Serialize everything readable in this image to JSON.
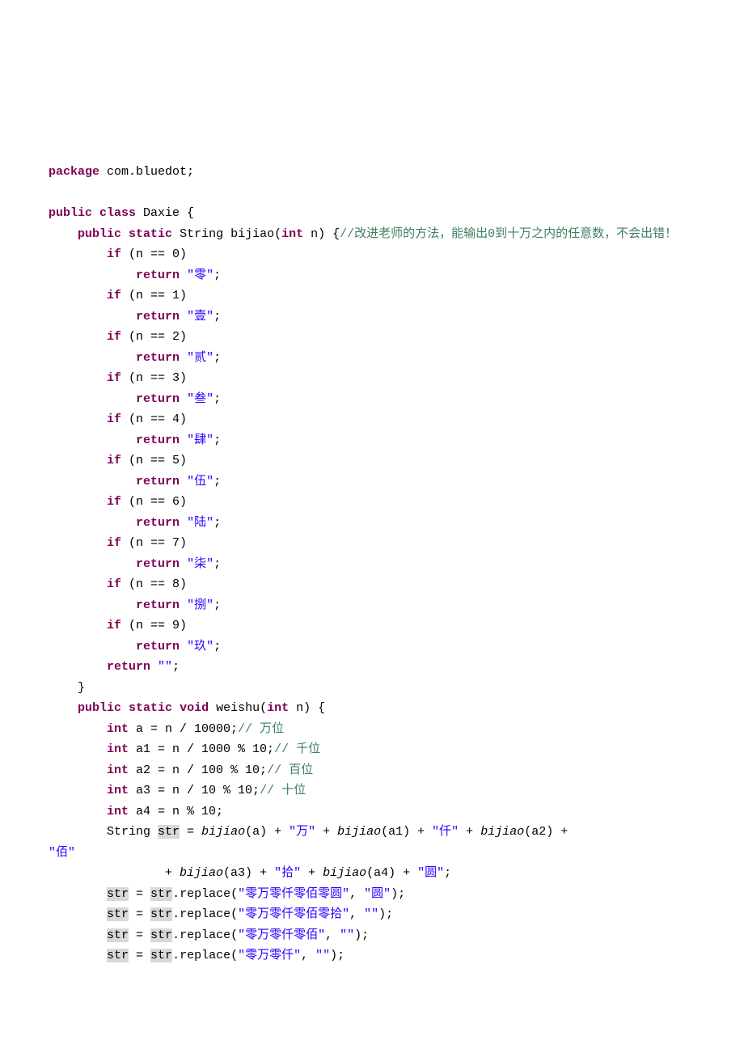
{
  "code": {
    "line_package": {
      "kw": "package",
      "rest": " com.bluedot;"
    },
    "blank": " ",
    "line_class": {
      "kw1": "public",
      "kw2": "class",
      "rest": " Daxie {"
    },
    "line_method_bijiao": {
      "indent": "    ",
      "kw1": "public",
      "kw2": "static",
      "ret": " String bijiao(",
      "kw3": "int",
      "args_rest": " n) {",
      "comment": "//改进老师的方法，能输出0到十万之内的任意数，不会出错！"
    },
    "if0": {
      "indent": "        ",
      "kw": "if",
      "rest": " (n == 0)"
    },
    "ret0": {
      "indent": "            ",
      "kw": "return",
      "sp": " ",
      "str": "\"零\"",
      "semi": ";"
    },
    "if1": {
      "indent": "        ",
      "kw": "if",
      "rest": " (n == 1)"
    },
    "ret1": {
      "indent": "            ",
      "kw": "return",
      "sp": " ",
      "str": "\"壹\"",
      "semi": ";"
    },
    "if2": {
      "indent": "        ",
      "kw": "if",
      "rest": " (n == 2)"
    },
    "ret2": {
      "indent": "            ",
      "kw": "return",
      "sp": " ",
      "str": "\"贰\"",
      "semi": ";"
    },
    "if3": {
      "indent": "        ",
      "kw": "if",
      "rest": " (n == 3)"
    },
    "ret3": {
      "indent": "            ",
      "kw": "return",
      "sp": " ",
      "str": "\"叁\"",
      "semi": ";"
    },
    "if4": {
      "indent": "        ",
      "kw": "if",
      "rest": " (n == 4)"
    },
    "ret4": {
      "indent": "            ",
      "kw": "return",
      "sp": " ",
      "str": "\"肆\"",
      "semi": ";"
    },
    "if5": {
      "indent": "        ",
      "kw": "if",
      "rest": " (n == 5)"
    },
    "ret5": {
      "indent": "            ",
      "kw": "return",
      "sp": " ",
      "str": "\"伍\"",
      "semi": ";"
    },
    "if6": {
      "indent": "        ",
      "kw": "if",
      "rest": " (n == 6)"
    },
    "ret6": {
      "indent": "            ",
      "kw": "return",
      "sp": " ",
      "str": "\"陆\"",
      "semi": ";"
    },
    "if7": {
      "indent": "        ",
      "kw": "if",
      "rest": " (n == 7)"
    },
    "ret7": {
      "indent": "            ",
      "kw": "return",
      "sp": " ",
      "str": "\"柒\"",
      "semi": ";"
    },
    "if8": {
      "indent": "        ",
      "kw": "if",
      "rest": " (n == 8)"
    },
    "ret8": {
      "indent": "            ",
      "kw": "return",
      "sp": " ",
      "str": "\"捌\"",
      "semi": ";"
    },
    "if9": {
      "indent": "        ",
      "kw": "if",
      "rest": " (n == 9)"
    },
    "ret9": {
      "indent": "            ",
      "kw": "return",
      "sp": " ",
      "str": "\"玖\"",
      "semi": ";"
    },
    "ret_empty": {
      "indent": "        ",
      "kw": "return",
      "sp": " ",
      "str": "\"\"",
      "semi": ";"
    },
    "close_bijiao": "    }",
    "line_method_weishu": {
      "indent": "    ",
      "kw1": "public",
      "kw2": "static",
      "kw3": "void",
      "name": " weishu(",
      "kw4": "int",
      "args_rest": " n) {"
    },
    "wa": {
      "indent": "        ",
      "kw": "int",
      "rest": " a = n / 10000;",
      "comment": "// 万位"
    },
    "wa1": {
      "indent": "        ",
      "kw": "int",
      "rest": " a1 = n / 1000 % 10;",
      "comment": "// 千位"
    },
    "wa2": {
      "indent": "        ",
      "kw": "int",
      "rest": " a2 = n / 100 % 10;",
      "comment": "// 百位"
    },
    "wa3": {
      "indent": "        ",
      "kw": "int",
      "rest": " a3 = n / 10 % 10;",
      "comment": "// 十位"
    },
    "wa4": {
      "indent": "        ",
      "kw": "int",
      "rest": " a4 = n % 10;"
    },
    "concat1": {
      "indent": "        ",
      "pre": "String ",
      "hl": "str",
      "eq": " = ",
      "m1": "bijiao",
      "t1": "(a) + ",
      "s1": "\"万\"",
      "t2": " + ",
      "m2": "bijiao",
      "t3": "(a1) + ",
      "s2": "\"仟\"",
      "t4": " + ",
      "m3": "bijiao",
      "t5": "(a2) + "
    },
    "concat1_cont": {
      "str": "\"佰\""
    },
    "concat2": {
      "indent": "                + ",
      "m1": "bijiao",
      "t1": "(a3) + ",
      "s1": "\"拾\"",
      "t2": " + ",
      "m2": "bijiao",
      "t3": "(a4) + ",
      "s2": "\"圆\"",
      "semi": ";"
    },
    "rep1": {
      "indent": "        ",
      "hl1": "str",
      "mid": " = ",
      "hl2": "str",
      "call": ".replace(",
      "s1": "\"零万零仟零佰零圆\"",
      "comma": ", ",
      "s2": "\"圆\"",
      "end": ");"
    },
    "rep2": {
      "indent": "        ",
      "hl1": "str",
      "mid": " = ",
      "hl2": "str",
      "call": ".replace(",
      "s1": "\"零万零仟零佰零拾\"",
      "comma": ", ",
      "s2": "\"\"",
      "end": ");"
    },
    "rep3": {
      "indent": "        ",
      "hl1": "str",
      "mid": " = ",
      "hl2": "str",
      "call": ".replace(",
      "s1": "\"零万零仟零佰\"",
      "comma": ", ",
      "s2": "\"\"",
      "end": ");"
    },
    "rep4": {
      "indent": "        ",
      "hl1": "str",
      "mid": " = ",
      "hl2": "str",
      "call": ".replace(",
      "s1": "\"零万零仟\"",
      "comma": ", ",
      "s2": "\"\"",
      "end": ");"
    }
  }
}
